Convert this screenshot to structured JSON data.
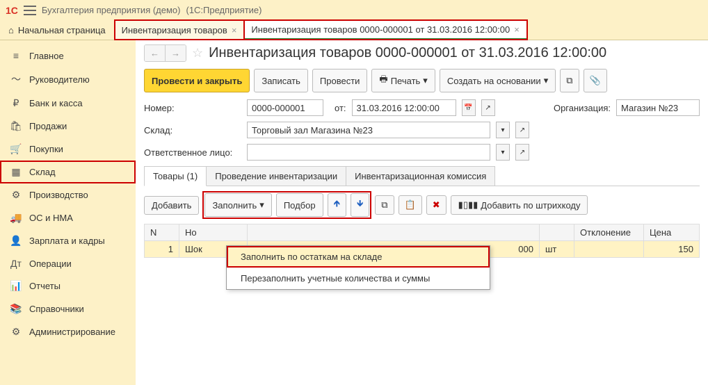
{
  "titlebar": {
    "app": "Бухгалтерия предприятия (демо)",
    "platform": "(1С:Предприятие)"
  },
  "home": "Начальная страница",
  "tabs": [
    {
      "label": "Инвентаризация товаров"
    },
    {
      "label": "Инвентаризация товаров 0000-000001 от 31.03.2016 12:00:00"
    }
  ],
  "sidebar": [
    {
      "label": "Главное",
      "icon": "≡"
    },
    {
      "label": "Руководителю",
      "icon": "〜"
    },
    {
      "label": "Банк и касса",
      "icon": "₽"
    },
    {
      "label": "Продажи",
      "icon": "🛍"
    },
    {
      "label": "Покупки",
      "icon": "🛒"
    },
    {
      "label": "Склад",
      "icon": "▦"
    },
    {
      "label": "Производство",
      "icon": "⚙"
    },
    {
      "label": "ОС и НМА",
      "icon": "🚚"
    },
    {
      "label": "Зарплата и кадры",
      "icon": "👤"
    },
    {
      "label": "Операции",
      "icon": "Дт"
    },
    {
      "label": "Отчеты",
      "icon": "📊"
    },
    {
      "label": "Справочники",
      "icon": "📚"
    },
    {
      "label": "Администрирование",
      "icon": "⚙"
    }
  ],
  "page": {
    "title": "Инвентаризация товаров 0000-000001 от 31.03.2016 12:00:00"
  },
  "toolbar": {
    "post_close": "Провести и закрыть",
    "save": "Записать",
    "post": "Провести",
    "print": "Печать",
    "create_based": "Создать на основании"
  },
  "form": {
    "number_label": "Номер:",
    "number": "0000-000001",
    "from_label": "от:",
    "date": "31.03.2016 12:00:00",
    "org_label": "Организация:",
    "org": "Магазин №23",
    "warehouse_label": "Склад:",
    "warehouse": "Торговый зал Магазина №23",
    "responsible_label": "Ответственное лицо:",
    "responsible": ""
  },
  "inner_tabs": [
    "Товары (1)",
    "Проведение инвентаризации",
    "Инвентаризационная комиссия"
  ],
  "table_toolbar": {
    "add": "Добавить",
    "fill": "Заполнить",
    "pick": "Подбор",
    "barcode": "Добавить по штрихкоду"
  },
  "dropdown": {
    "item1": "Заполнить по остаткам на складе",
    "item2": "Перезаполнить учетные количества и суммы"
  },
  "columns": {
    "n": "N",
    "name": "Но",
    "qty": "000",
    "unit": "шт",
    "deviation": "Отклонение",
    "price": "Цена"
  },
  "rows": [
    {
      "n": "1",
      "name": "Шок",
      "qty": "000",
      "unit": "шт",
      "price": "150"
    }
  ]
}
